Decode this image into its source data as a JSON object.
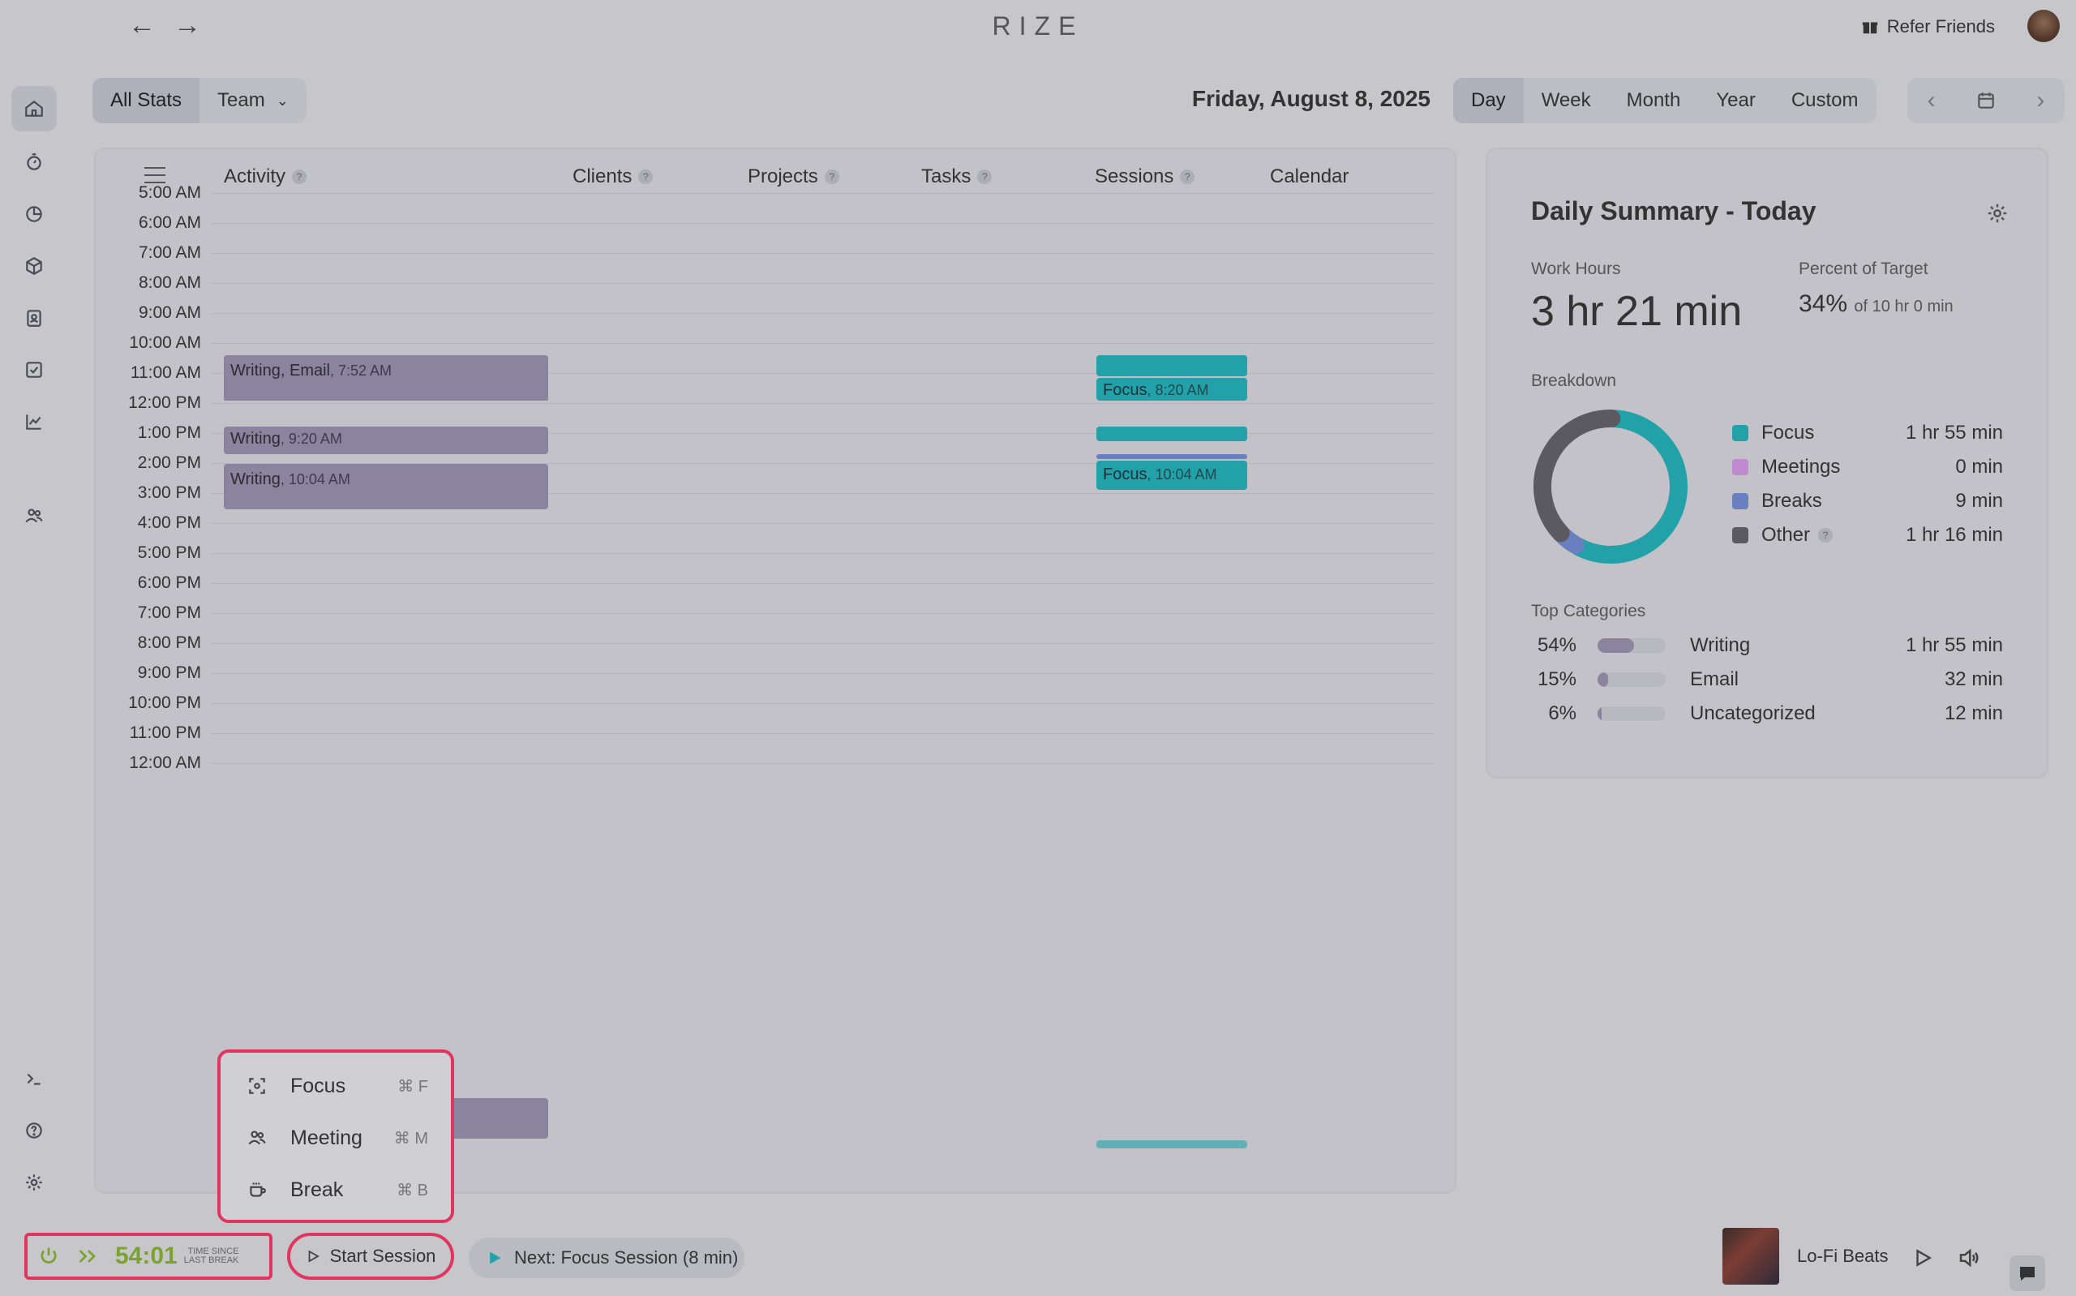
{
  "app": {
    "brand": "RIZE",
    "refer_label": "Refer Friends"
  },
  "filters": {
    "all_stats": "All Stats",
    "team": "Team"
  },
  "date_title": "Friday, August 8, 2025",
  "range_tabs": [
    "Day",
    "Week",
    "Month",
    "Year",
    "Custom"
  ],
  "columns": {
    "activity": "Activity",
    "clients": "Clients",
    "projects": "Projects",
    "tasks": "Tasks",
    "sessions": "Sessions",
    "calendar": "Calendar"
  },
  "hours": [
    "5:00 AM",
    "6:00 AM",
    "7:00 AM",
    "8:00 AM",
    "9:00 AM",
    "10:00 AM",
    "11:00 AM",
    "12:00 PM",
    "1:00 PM",
    "2:00 PM",
    "3:00 PM",
    "4:00 PM",
    "5:00 PM",
    "6:00 PM",
    "7:00 PM",
    "8:00 PM",
    "9:00 PM",
    "10:00 PM",
    "11:00 PM",
    "12:00 AM"
  ],
  "activity_blocks": [
    {
      "name": "Writing, Email",
      "time": ", 7:52 AM"
    },
    {
      "name": "Writing",
      "time": ", 9:20 AM"
    },
    {
      "name": "Writing",
      "time": ", 10:04 AM"
    }
  ],
  "session_blocks": [
    {
      "name": "Focus",
      "time": ", 8:20 AM"
    },
    {
      "name": "Focus",
      "time": ", 10:04 AM"
    }
  ],
  "summary": {
    "title": "Daily Summary - Today",
    "work_hours_label": "Work Hours",
    "work_hours_value": "3 hr 21 min",
    "percent_label": "Percent of Target",
    "percent_value": "34%",
    "percent_of": "of 10 hr 0 min",
    "breakdown_label": "Breakdown",
    "breakdown": [
      {
        "name": "Focus",
        "value": "1 hr 55 min",
        "color": "#22a2a8"
      },
      {
        "name": "Meetings",
        "value": "0 min",
        "color": "#c08ad0"
      },
      {
        "name": "Breaks",
        "value": "9 min",
        "color": "#6a7fc0"
      },
      {
        "name": "Other",
        "value": "1 hr 16 min",
        "color": "#5a5a60"
      }
    ],
    "top_categories_label": "Top Categories",
    "categories": [
      {
        "pct": "54%",
        "name": "Writing",
        "value": "1 hr 55 min",
        "fill": 0.54
      },
      {
        "pct": "15%",
        "name": "Email",
        "value": "32 min",
        "fill": 0.15
      },
      {
        "pct": "6%",
        "name": "Uncategorized",
        "value": "12 min",
        "fill": 0.06
      }
    ]
  },
  "popup": {
    "items": [
      {
        "label": "Focus",
        "key": "⌘ F"
      },
      {
        "label": "Meeting",
        "key": "⌘ M"
      },
      {
        "label": "Break",
        "key": "⌘ B"
      }
    ]
  },
  "bottom": {
    "timer": "54:01",
    "timer_caption_1": "TIME SINCE",
    "timer_caption_2": "LAST BREAK",
    "start_session": "Start Session",
    "next_label": "Next:",
    "next_value": "Focus Session",
    "next_duration": "(8 min)",
    "music_title": "Lo-Fi Beats"
  }
}
